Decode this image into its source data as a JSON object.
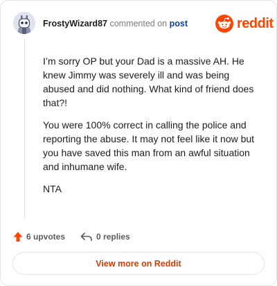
{
  "comment_header": {
    "username": "FrostyWizard87",
    "action_text": "commented on",
    "post_link": "post"
  },
  "brand": {
    "name": "reddit",
    "color": "#ff4500",
    "icon": "reddit-logo-icon"
  },
  "comment": {
    "paragraphs": [
      "I’m sorry OP but your Dad is a massive AH. He knew Jimmy was severely ill and was being abused and did nothing. What kind of friend does that?!",
      "You were 100% correct in calling the police and reporting the abuse. It may not feel like it now but you have saved this man from an awful situation and inhumane wife.",
      "NTA"
    ]
  },
  "actions": {
    "upvotes_label": "6 upvotes",
    "upvote_icon": "upvote-arrow-icon",
    "replies_label": "0 replies",
    "reply_icon": "reply-arrow-icon"
  },
  "footer": {
    "view_more_label": "View more on Reddit"
  },
  "colors": {
    "accent": "#ff4500",
    "link": "#0a449b",
    "view_more_text": "#d93a00"
  }
}
